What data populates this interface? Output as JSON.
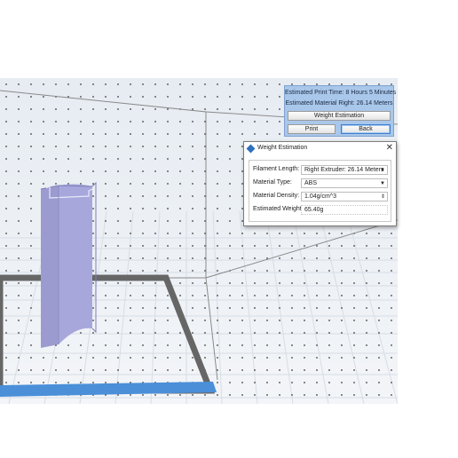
{
  "estimate_panel": {
    "print_time_label": "Estimated Print Time:",
    "print_time_value": "8 Hours 5 Minutes",
    "material_label": "Estimated Material Right:",
    "material_value": "26.14 Meters",
    "weight_button": "Weight Estimation",
    "print_button": "Print",
    "back_button": "Back"
  },
  "dialog": {
    "title": "Weight Estimation",
    "close_glyph": "✕",
    "filament_length_label": "Filament Length:",
    "filament_length_value": "Right Extruder: 26.14 Meters",
    "material_type_label": "Material Type:",
    "material_type_value": "ABS",
    "material_density_label": "Material Density:",
    "material_density_value": "1.04g/cm^3",
    "estimated_weight_label": "Estimated Weight:",
    "estimated_weight_value": "65.40g",
    "dropdown_glyph": "▼",
    "spin_glyph": "⇕"
  },
  "colors": {
    "panel_bg": "#a9c7ea",
    "model": "#a5a4d8",
    "build_plate_edge": "#666666",
    "selection_edge": "#4a8fd8"
  }
}
